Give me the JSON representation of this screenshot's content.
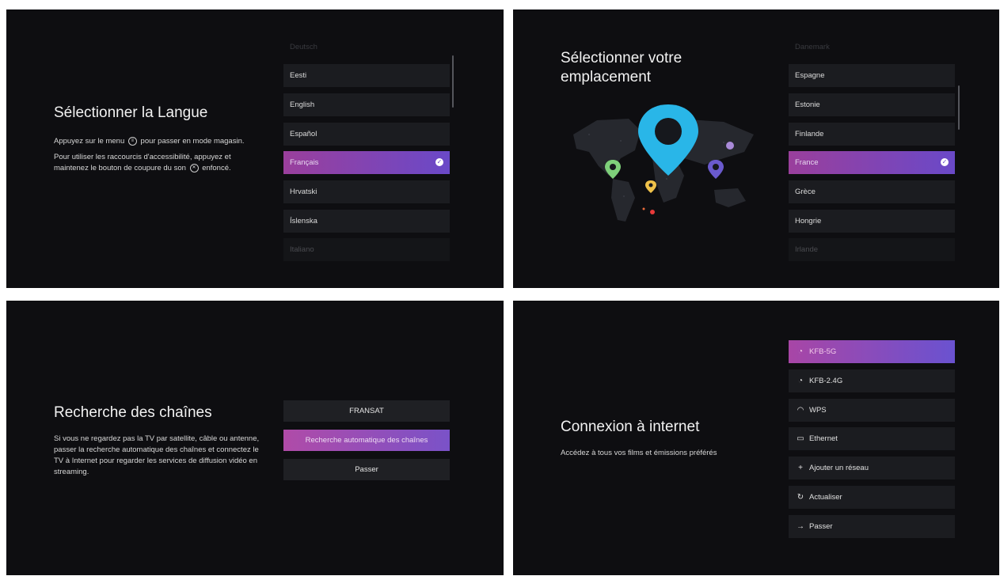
{
  "language": {
    "title": "Sélectionner la Langue",
    "desc1_a": "Appuyez sur le menu",
    "desc1_b": "pour passer en mode magasin.",
    "desc2_a": "Pour utiliser les raccourcis d'accessibilité, appuyez et maintenez le bouton de coupure du son",
    "desc2_b": "enfoncé.",
    "items": [
      "Deutsch",
      "Eesti",
      "English",
      "Español",
      "Français",
      "Hrvatski",
      "Íslenska",
      "Italiano"
    ],
    "selected": "Français"
  },
  "location": {
    "title_line1": "Sélectionner votre",
    "title_line2": "emplacement",
    "items": [
      "Danemark",
      "Espagne",
      "Estonie",
      "Finlande",
      "France",
      "Grèce",
      "Hongrie",
      "Irlande"
    ],
    "selected": "France"
  },
  "channels": {
    "title": "Recherche des chaînes",
    "desc": "Si vous ne regardez pas la TV par satellite, câble ou antenne, passer la recherche automatique des chaînes et connectez le TV à Internet pour regarder les services de diffusion vidéo en streaming.",
    "buttons": [
      "FRANSAT",
      "Recherche automatique des chaînes",
      "Passer"
    ]
  },
  "internet": {
    "title": "Connexion à internet",
    "desc": "Accédez à tous vos films et émissions préférés",
    "items": [
      {
        "label": "KFB-5G",
        "icon": "wifi-lock-icon"
      },
      {
        "label": "KFB-2.4G",
        "icon": "wifi-lock-icon"
      },
      {
        "label": "WPS",
        "icon": "wifi-icon"
      },
      {
        "label": "Ethernet",
        "icon": "ethernet-icon"
      },
      {
        "label": "Ajouter un réseau",
        "icon": "plus-icon"
      },
      {
        "label": "Actualiser",
        "icon": "refresh-icon"
      },
      {
        "label": "Passer",
        "icon": "arrow-right-icon"
      }
    ]
  },
  "colors": {
    "background": "#0e0e11",
    "item_bg": "#1b1c20",
    "accent_start": "#9a3f9c",
    "accent_end": "#6a49c8",
    "pin_blue": "#29b6e8",
    "pin_green": "#7ed07a",
    "pin_purple": "#6a5acd",
    "pin_yellow": "#f0c24a"
  }
}
